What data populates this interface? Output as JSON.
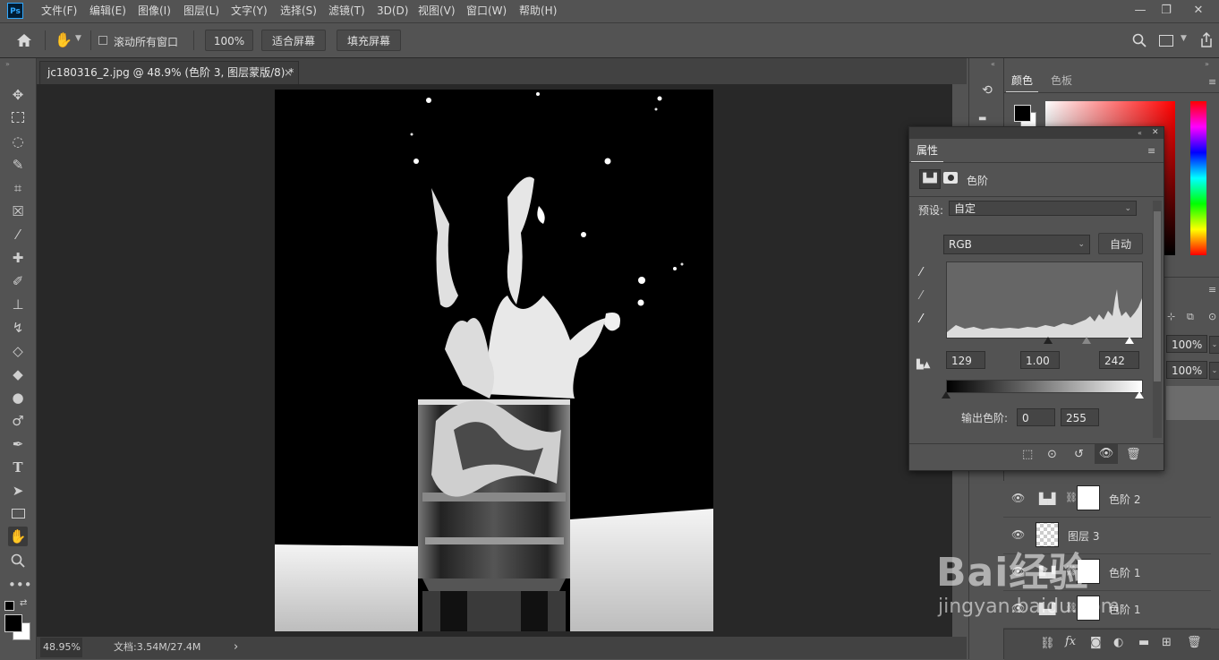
{
  "app": {
    "logo": "Ps"
  },
  "menu": [
    "文件(F)",
    "编辑(E)",
    "图像(I)",
    "图层(L)",
    "文字(Y)",
    "选择(S)",
    "滤镜(T)",
    "3D(D)",
    "视图(V)",
    "窗口(W)",
    "帮助(H)"
  ],
  "window_controls": {
    "minimize": "—",
    "restore": "❐",
    "close": "✕"
  },
  "options": {
    "scroll_all_label": "滚动所有窗口",
    "zoom_value": "100%",
    "fit_screen": "适合屏幕",
    "fill_screen": "填充屏幕"
  },
  "document": {
    "tab_title": "jc180316_2.jpg @ 48.9% (色阶 3, 图层蒙版/8) *",
    "tab_close": "×"
  },
  "status": {
    "zoom": "48.95%",
    "doc_size": "文档:3.54M/27.4M",
    "arrow": "›"
  },
  "color_panel": {
    "tab_color": "颜色",
    "tab_swatches": "色板"
  },
  "properties": {
    "title": "属性",
    "adjustment_name": "色阶",
    "preset_label": "预设:",
    "preset_value": "自定",
    "channel": "RGB",
    "auto_button": "自动",
    "input_black": "129",
    "input_gamma": "1.00",
    "input_white": "242",
    "output_label": "输出色阶:",
    "output_black": "0",
    "output_white": "255"
  },
  "layers_panel": {
    "opacity_value": "100%",
    "fill_value": "100%",
    "layers": [
      {
        "name": "色阶 2",
        "type": "adjustment"
      },
      {
        "name": "图层 3",
        "type": "transparent"
      },
      {
        "name": "色阶 1",
        "type": "adjustment"
      },
      {
        "name": "色阶 1",
        "type": "adjustment"
      }
    ]
  },
  "watermark": {
    "brand": "Bai经验",
    "url": "jingyan.baidu.com"
  }
}
